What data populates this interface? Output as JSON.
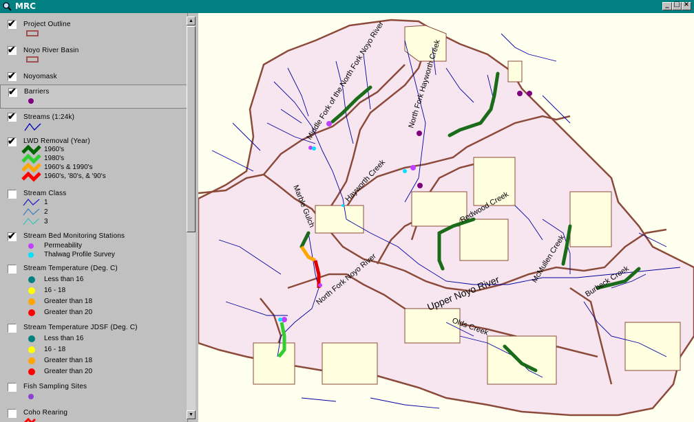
{
  "window": {
    "title": "MRC"
  },
  "toc": {
    "layers": [
      {
        "label": "Project Outline",
        "checked": true
      },
      {
        "label": "Noyo River Basin",
        "checked": true
      },
      {
        "label": "Noyomask",
        "checked": true
      },
      {
        "label": "Barriers",
        "checked": true
      },
      {
        "label": "Streams (1:24k)",
        "checked": true
      },
      {
        "label": "LWD Removal (Year)",
        "checked": true,
        "classes": [
          {
            "label": "1960's",
            "color": "#006400"
          },
          {
            "label": "1980's",
            "color": "#32cd32"
          },
          {
            "label": "1960's & 1990's",
            "color": "#ffa500"
          },
          {
            "label": "1960's, '80's, & '90's",
            "color": "#ff0000"
          }
        ]
      },
      {
        "label": "Stream Class",
        "checked": false,
        "classes": [
          {
            "label": "1"
          },
          {
            "label": "2"
          },
          {
            "label": "3"
          }
        ]
      },
      {
        "label": "Stream Bed Monitoring Stations",
        "checked": true,
        "classes": [
          {
            "label": "Permeability",
            "color": "#c040ff"
          },
          {
            "label": "Thalwag Profile Survey",
            "color": "#00e0ff"
          }
        ]
      },
      {
        "label": "Stream Temperature (Deg. C)",
        "checked": false,
        "classes": [
          {
            "label": "Less than 16",
            "color": "#008080"
          },
          {
            "label": "16 - 18",
            "color": "#ffff00"
          },
          {
            "label": "Greater than 18",
            "color": "#ffa500"
          },
          {
            "label": "Greater than 20",
            "color": "#ff0000"
          }
        ]
      },
      {
        "label": "Stream Temperature JDSF (Deg. C)",
        "checked": false,
        "classes": [
          {
            "label": "Less than 16",
            "color": "#008080"
          },
          {
            "label": "16 - 18",
            "color": "#ffff00"
          },
          {
            "label": "Greater than 18",
            "color": "#ffa500"
          },
          {
            "label": "Greater than 20",
            "color": "#ff0000"
          }
        ]
      },
      {
        "label": "Fish Sampling Sites",
        "checked": false
      },
      {
        "label": "Coho Rearing",
        "checked": false
      }
    ]
  },
  "map": {
    "labels": {
      "middle_fork": "Middle Fork of the North Fork Noyo River",
      "north_fork_hayworth": "North Fork Hayworth Creek",
      "hayworth": "Hayworth Creek",
      "marble_gulch": "Marble Gulch",
      "redwood": "Redwood Creek",
      "mcmullen": "McMullen Creek",
      "north_fork_noyo": "North Fork Noyo River",
      "upper_noyo": "Upper Noyo River",
      "olds": "Olds Creek",
      "burbeck": "Burbeck Creek"
    },
    "colors": {
      "stream": "#0000a0",
      "boundary": "#8b4a3a",
      "basin_fill": "#f5e6f0",
      "outside_fill": "#ffffe0",
      "lwd_1960": "#006400",
      "barrier": "#800080"
    }
  }
}
